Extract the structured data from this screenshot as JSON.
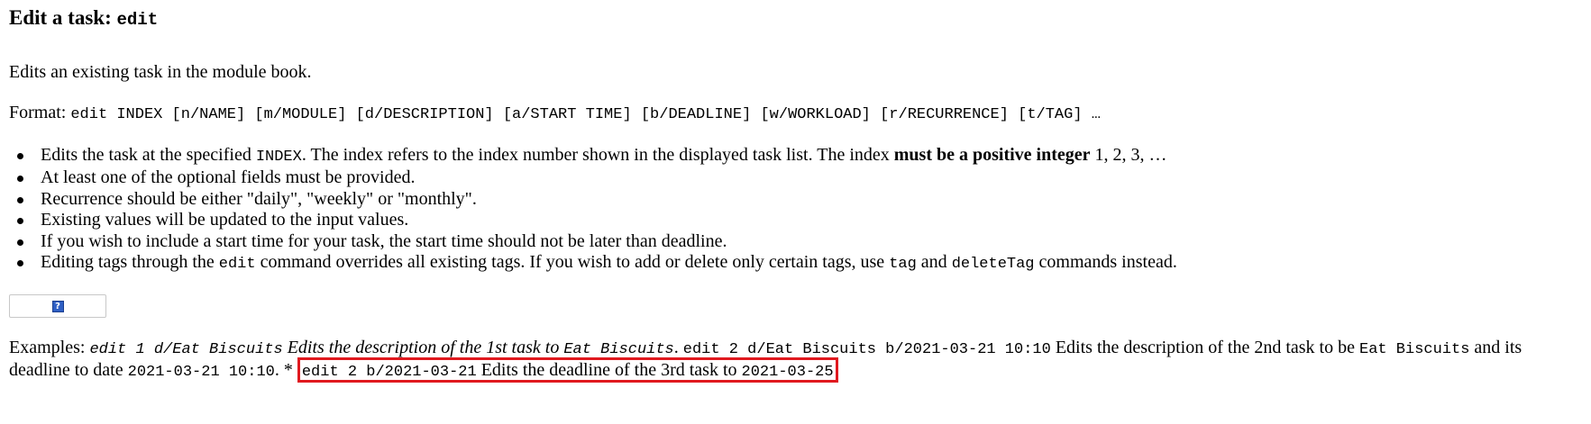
{
  "heading": {
    "text": "Edit a task: ",
    "command": "edit"
  },
  "intro": "Edits an existing task in the module book.",
  "format": {
    "label": "Format: ",
    "syntax": "edit INDEX [n/NAME] [m/MODULE] [d/DESCRIPTION] [a/START TIME] [b/DEADLINE] [w/WORKLOAD] [r/RECURRENCE] [t/TAG] …"
  },
  "rules": {
    "r1": {
      "a": "Edits the task at the specified ",
      "code": "INDEX",
      "b": ". The index refers to the index number shown in the displayed task list. The index ",
      "strong": "must be a positive integer",
      "c": " 1, 2, 3, …"
    },
    "r2": "At least one of the optional fields must be provided.",
    "r3": "Recurrence should be either \"daily\", \"weekly\" or \"monthly\".",
    "r4": "Existing values will be updated to the input values.",
    "r5": "If you wish to include a start time for your task, the start time should not be later than deadline.",
    "r6": {
      "a": "Editing tags through the ",
      "code1": "edit",
      "b": " command overrides all existing tags. If you wish to add or delete only certain tags, use ",
      "code2": "tag",
      "c": " and ",
      "code3": "deleteTag",
      "d": " commands instead."
    }
  },
  "image": {
    "icon": "broken-image-icon",
    "glyph": "?"
  },
  "examples": {
    "label": "Examples: ",
    "e1_cmd": "edit 1 d/Eat Biscuits",
    "e1_desc": " Edits the description of the 1st task to ",
    "e1_value": "Eat Biscuits",
    "e1_end": ".",
    "e2_cmd": "edit 2 d/Eat Biscuits b/2021-03-21 10:10",
    "e2_desc": " Edits the description of the 2nd task to be ",
    "e2_value": "Eat Biscuits",
    "e2_mid": " and its deadline to date ",
    "e2_date": "2021-03-21 10:10",
    "e2_end": ". * ",
    "e3_cmd": "edit 2 b/2021-03-21",
    "e3_desc": " Edits the deadline of the 3rd task to ",
    "e3_date": "2021-03-25"
  },
  "colors": {
    "highlight_border": "#e0191f",
    "text": "#000000"
  }
}
